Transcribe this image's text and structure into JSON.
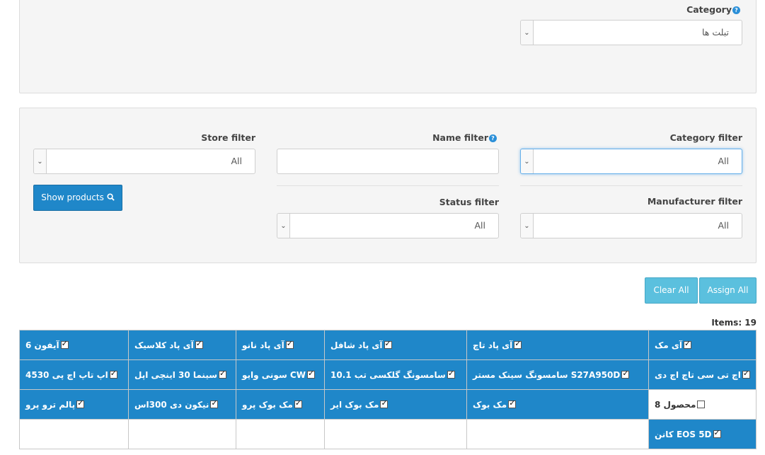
{
  "top_panel": {
    "category_label": "Category",
    "category_value": "تبلت ها"
  },
  "filters": {
    "store_label": "Store filter",
    "store_value": "All",
    "name_label": "Name filter",
    "name_value": "",
    "category_label": "Category filter",
    "category_value": "All",
    "status_label": "Status filter",
    "status_value": "All",
    "manufacturer_label": "Manufacturer filter",
    "manufacturer_value": "All",
    "show_products_label": "Show products"
  },
  "actions": {
    "clear_all": "Clear All",
    "assign_all": "Assign All"
  },
  "items_count": "Items: 19",
  "products": [
    [
      {
        "name": "آیفون 6",
        "checked": true
      },
      {
        "name": "آی پاد کلاسیک",
        "checked": true
      },
      {
        "name": "آی پاد نانو",
        "checked": true
      },
      {
        "name": "آی پاد شافل",
        "checked": true
      },
      {
        "name": "آی پاد تاچ",
        "checked": true
      },
      {
        "name": "آی مک",
        "checked": true
      }
    ],
    [
      {
        "name": "اپ تاپ اچ پی 4530",
        "checked": true
      },
      {
        "name": "سینما 30 اینچی اپل",
        "checked": true
      },
      {
        "name": "سونی وایو CW",
        "checked": true
      },
      {
        "name": "سامسونگ گلکسی تب 10.1",
        "checked": true
      },
      {
        "name": "سامسونگ سینک مستر S27A950D",
        "checked": true
      },
      {
        "name": "اچ تی سی تاچ اچ دی",
        "checked": true
      }
    ],
    [
      {
        "name": "پالم ترو پرو",
        "checked": true
      },
      {
        "name": "نیکون دی 300اس",
        "checked": true
      },
      {
        "name": "مک بوک پرو",
        "checked": true
      },
      {
        "name": "مک بوک ایر",
        "checked": true
      },
      {
        "name": "مک بوک",
        "checked": true
      },
      {
        "name": "محصول 8",
        "checked": false
      }
    ],
    [
      null,
      null,
      null,
      null,
      null,
      {
        "name": "کانن EOS 5D",
        "checked": true
      }
    ]
  ],
  "icons": {
    "help": "question-circle-icon",
    "search": "search-icon",
    "dropdown": "chevron-down-icon",
    "checkbox": "checkbox-icon"
  },
  "colors": {
    "primary": "#1f87c9",
    "info": "#5bc0de"
  }
}
